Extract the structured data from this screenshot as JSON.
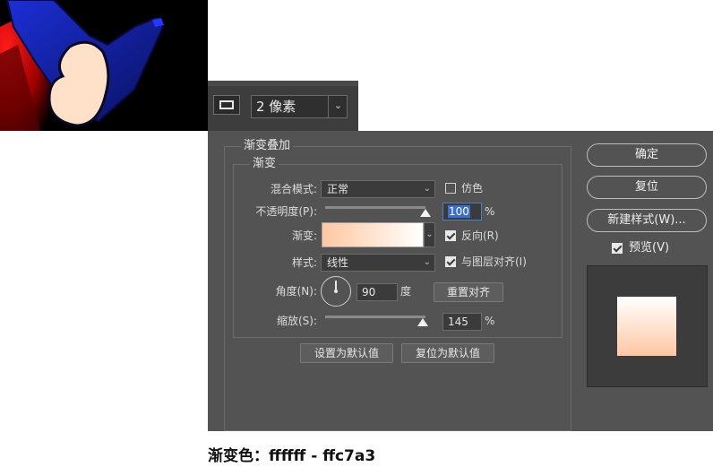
{
  "toolbar": {
    "stroke_size": "2 像素",
    "stroke_size_arrow": "⌄"
  },
  "dialog": {
    "section_title": "渐变叠加",
    "group_title": "渐变",
    "blend_mode_label": "混合模式:",
    "blend_mode_value": "正常",
    "dither_label": "仿色",
    "dither_checked": false,
    "opacity_label": "不透明度(P):",
    "opacity_value": "100",
    "opacity_unit": "%",
    "opacity_level": 1.0,
    "gradient_label": "渐变:",
    "reverse_label": "反向(R)",
    "reverse_checked": true,
    "style_label": "样式:",
    "style_value": "线性",
    "align_layer_label": "与图层对齐(I)",
    "align_layer_checked": true,
    "angle_label": "角度(N):",
    "angle_value": "90",
    "angle_unit": "度",
    "reset_alignment_label": "重置对齐",
    "scale_label": "缩放(S):",
    "scale_value": "145",
    "scale_unit": "%",
    "scale_level": 0.97,
    "set_default_label": "设置为默认值",
    "reset_default_label": "复位为默认值",
    "dropdown_arrow": "⌄"
  },
  "side_buttons": {
    "ok_label": "确定",
    "reset_label": "复位",
    "new_style_label": "新建样式(W)...",
    "preview_label": "预览(V)",
    "preview_checked": true
  },
  "colors": {
    "gradient_start": "#ffc7a3",
    "gradient_end": "#ffffff",
    "dialog_bg": "#535353"
  },
  "caption": "渐变色：ffffff - ffc7a3"
}
